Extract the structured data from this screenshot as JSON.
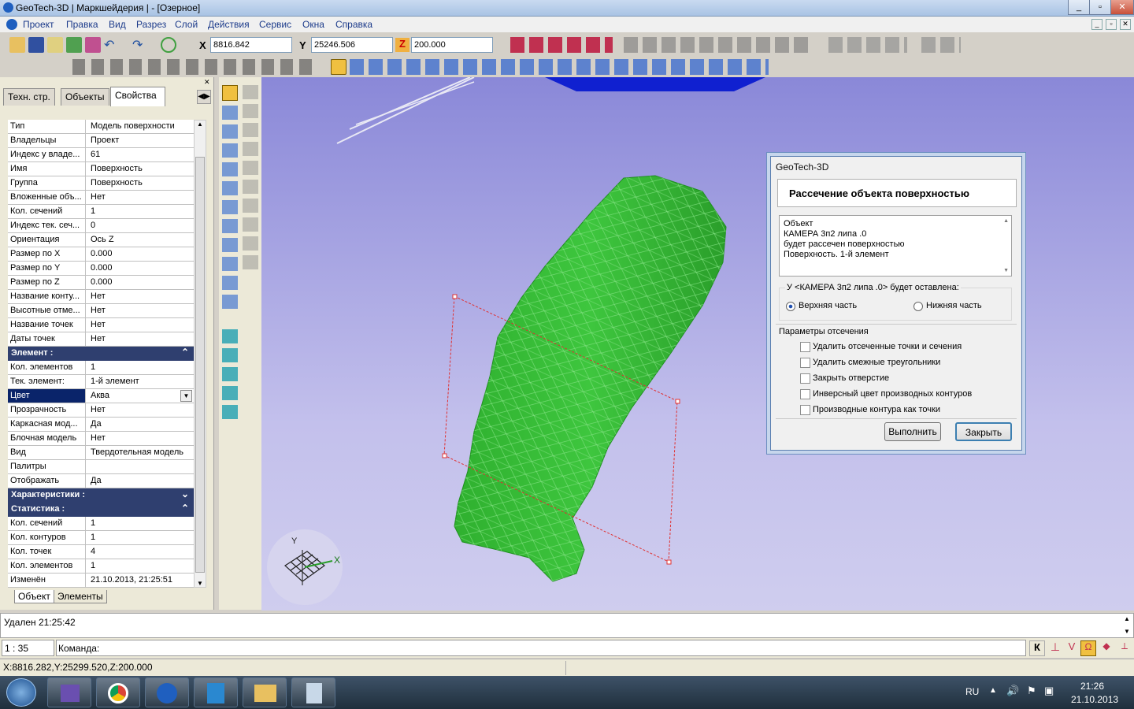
{
  "window": {
    "title": "GeoTech-3D | Маркшейдерия | - [Озерное]"
  },
  "menu": [
    "Проект",
    "Правка",
    "Вид",
    "Разрез",
    "Слой",
    "Действия",
    "Сервис",
    "Окна",
    "Справка"
  ],
  "coords": {
    "x_label": "X",
    "x_value": "8816.842",
    "y_label": "Y",
    "y_value": "25246.506",
    "z_label": "Z",
    "z_value": "200.000"
  },
  "left_tabs": [
    "Техн. стр.",
    "Объекты",
    "Свойства"
  ],
  "properties": [
    {
      "n": "Тип",
      "v": "Модель поверхности"
    },
    {
      "n": "Владельцы",
      "v": "Проект"
    },
    {
      "n": "Индекс у владе...",
      "v": "61"
    },
    {
      "n": "Имя",
      "v": "Поверхность"
    },
    {
      "n": "Группа",
      "v": "Поверхность"
    },
    {
      "n": "Вложенные объ...",
      "v": "Нет"
    },
    {
      "n": "Кол. сечений",
      "v": "1"
    },
    {
      "n": "Индекс тек. сеч...",
      "v": "0"
    },
    {
      "n": "Ориентация",
      "v": "Ось Z"
    },
    {
      "n": "Размер по X",
      "v": "0.000"
    },
    {
      "n": "Размер по Y",
      "v": "0.000"
    },
    {
      "n": "Размер по Z",
      "v": "0.000"
    },
    {
      "n": "Название конту...",
      "v": "Нет"
    },
    {
      "n": "Высотные отме...",
      "v": "Нет"
    },
    {
      "n": "Название точек",
      "v": "Нет"
    },
    {
      "n": "Даты точек",
      "v": "Нет"
    }
  ],
  "section_element": "Элемент :",
  "element_props": [
    {
      "n": "Кол. элементов",
      "v": "1"
    },
    {
      "n": "Тек. элемент:",
      "v": "1-й элемент"
    }
  ],
  "color_prop": {
    "n": "Цвет",
    "v": "Аква"
  },
  "element_props2": [
    {
      "n": "Прозрачность",
      "v": "Нет"
    },
    {
      "n": "Каркасная мод...",
      "v": "Да"
    },
    {
      "n": "Блочная модель",
      "v": "Нет"
    },
    {
      "n": "Вид",
      "v": "Твердотельная модель"
    },
    {
      "n": "Палитры",
      "v": ""
    },
    {
      "n": "Отображать",
      "v": "Да"
    }
  ],
  "section_char": "Характеристики :",
  "section_stat": "Статистика :",
  "stat_props": [
    {
      "n": "Кол. сечений",
      "v": "1"
    },
    {
      "n": "Кол. контуров",
      "v": "1"
    },
    {
      "n": "Кол. точек",
      "v": "4"
    },
    {
      "n": "Кол. элементов",
      "v": "1"
    },
    {
      "n": "Изменён",
      "v": "21.10.2013, 21:25:51"
    }
  ],
  "bottom_tabs": [
    "Объект",
    "Элементы"
  ],
  "axis": {
    "y": "Y",
    "x": "X"
  },
  "dialog": {
    "title": "GeoTech-3D",
    "header": "Рассечение объекта поверхностью",
    "message": [
      "Объект",
      "КАМЕРА 3п2 липа .0",
      "будет рассечен поверхностью",
      "Поверхность. 1-й элемент"
    ],
    "keep_label": "У <КАМЕРА 3п2 липа .0> будет оставлена:",
    "radio_upper": "Верхняя часть",
    "radio_lower": "Нижняя часть",
    "params_label": "Параметры отсечения",
    "checks": [
      "Удалить отсеченные точки и сечения",
      "Удалить смежные треугольники",
      "Закрыть отверстие",
      "Инверсный цвет производных контуров",
      "Производные контура как точки"
    ],
    "run": "Выполнить",
    "close": "Закрыть"
  },
  "output_text": "Удален 21:25:42",
  "scale": "1 : 35",
  "command_label": "Команда:",
  "snap_k": "К",
  "status_coords": "X:8816.282,Y:25299.520,Z:200.000",
  "tray": {
    "lang": "RU",
    "time": "21:26",
    "date": "21.10.2013"
  },
  "colors": {
    "mesh": "#3fbf3f",
    "accent": "#2f3f6f",
    "selection": "#0a246a"
  }
}
